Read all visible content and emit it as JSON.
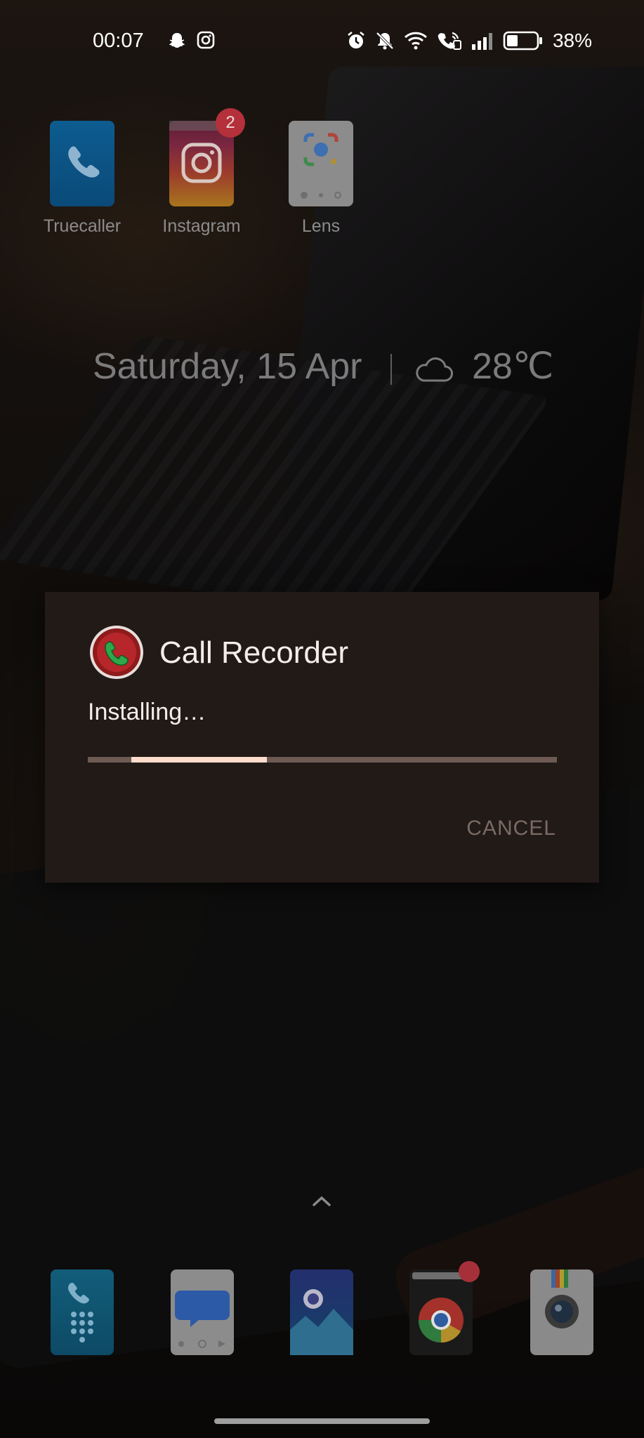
{
  "status_bar": {
    "time": "00:07",
    "battery_percent": "38%",
    "notification_icons": [
      "snapchat-icon",
      "instagram-icon"
    ],
    "system_icons": [
      "alarm-icon",
      "mute-icon",
      "wifi-icon",
      "volte-call-icon",
      "signal-icon",
      "battery-icon"
    ]
  },
  "home_apps": [
    {
      "label": "Truecaller",
      "icon": "phone-icon"
    },
    {
      "label": "Instagram",
      "icon": "instagram-icon",
      "badge": "2"
    },
    {
      "label": "Lens",
      "icon": "lens-icon"
    }
  ],
  "widget": {
    "date": "Saturday, 15 Apr",
    "weather_icon": "cloud-icon",
    "temperature": "28℃"
  },
  "dialog": {
    "app_name": "Call Recorder",
    "message": "Installing…",
    "progress_fraction": 0.22,
    "cancel_label": "CANCEL"
  },
  "dock": [
    "phone-dialer-icon",
    "messages-icon",
    "gallery-icon",
    "chrome-icon",
    "camera-icon"
  ],
  "colors": {
    "dialog_bg": "#211a17",
    "dialog_text": "#f7ede8",
    "progress_track": "#6d5b53",
    "progress_fill": "#ffdccb",
    "cancel_text": "#7b6a63",
    "badge": "#b4303a"
  }
}
